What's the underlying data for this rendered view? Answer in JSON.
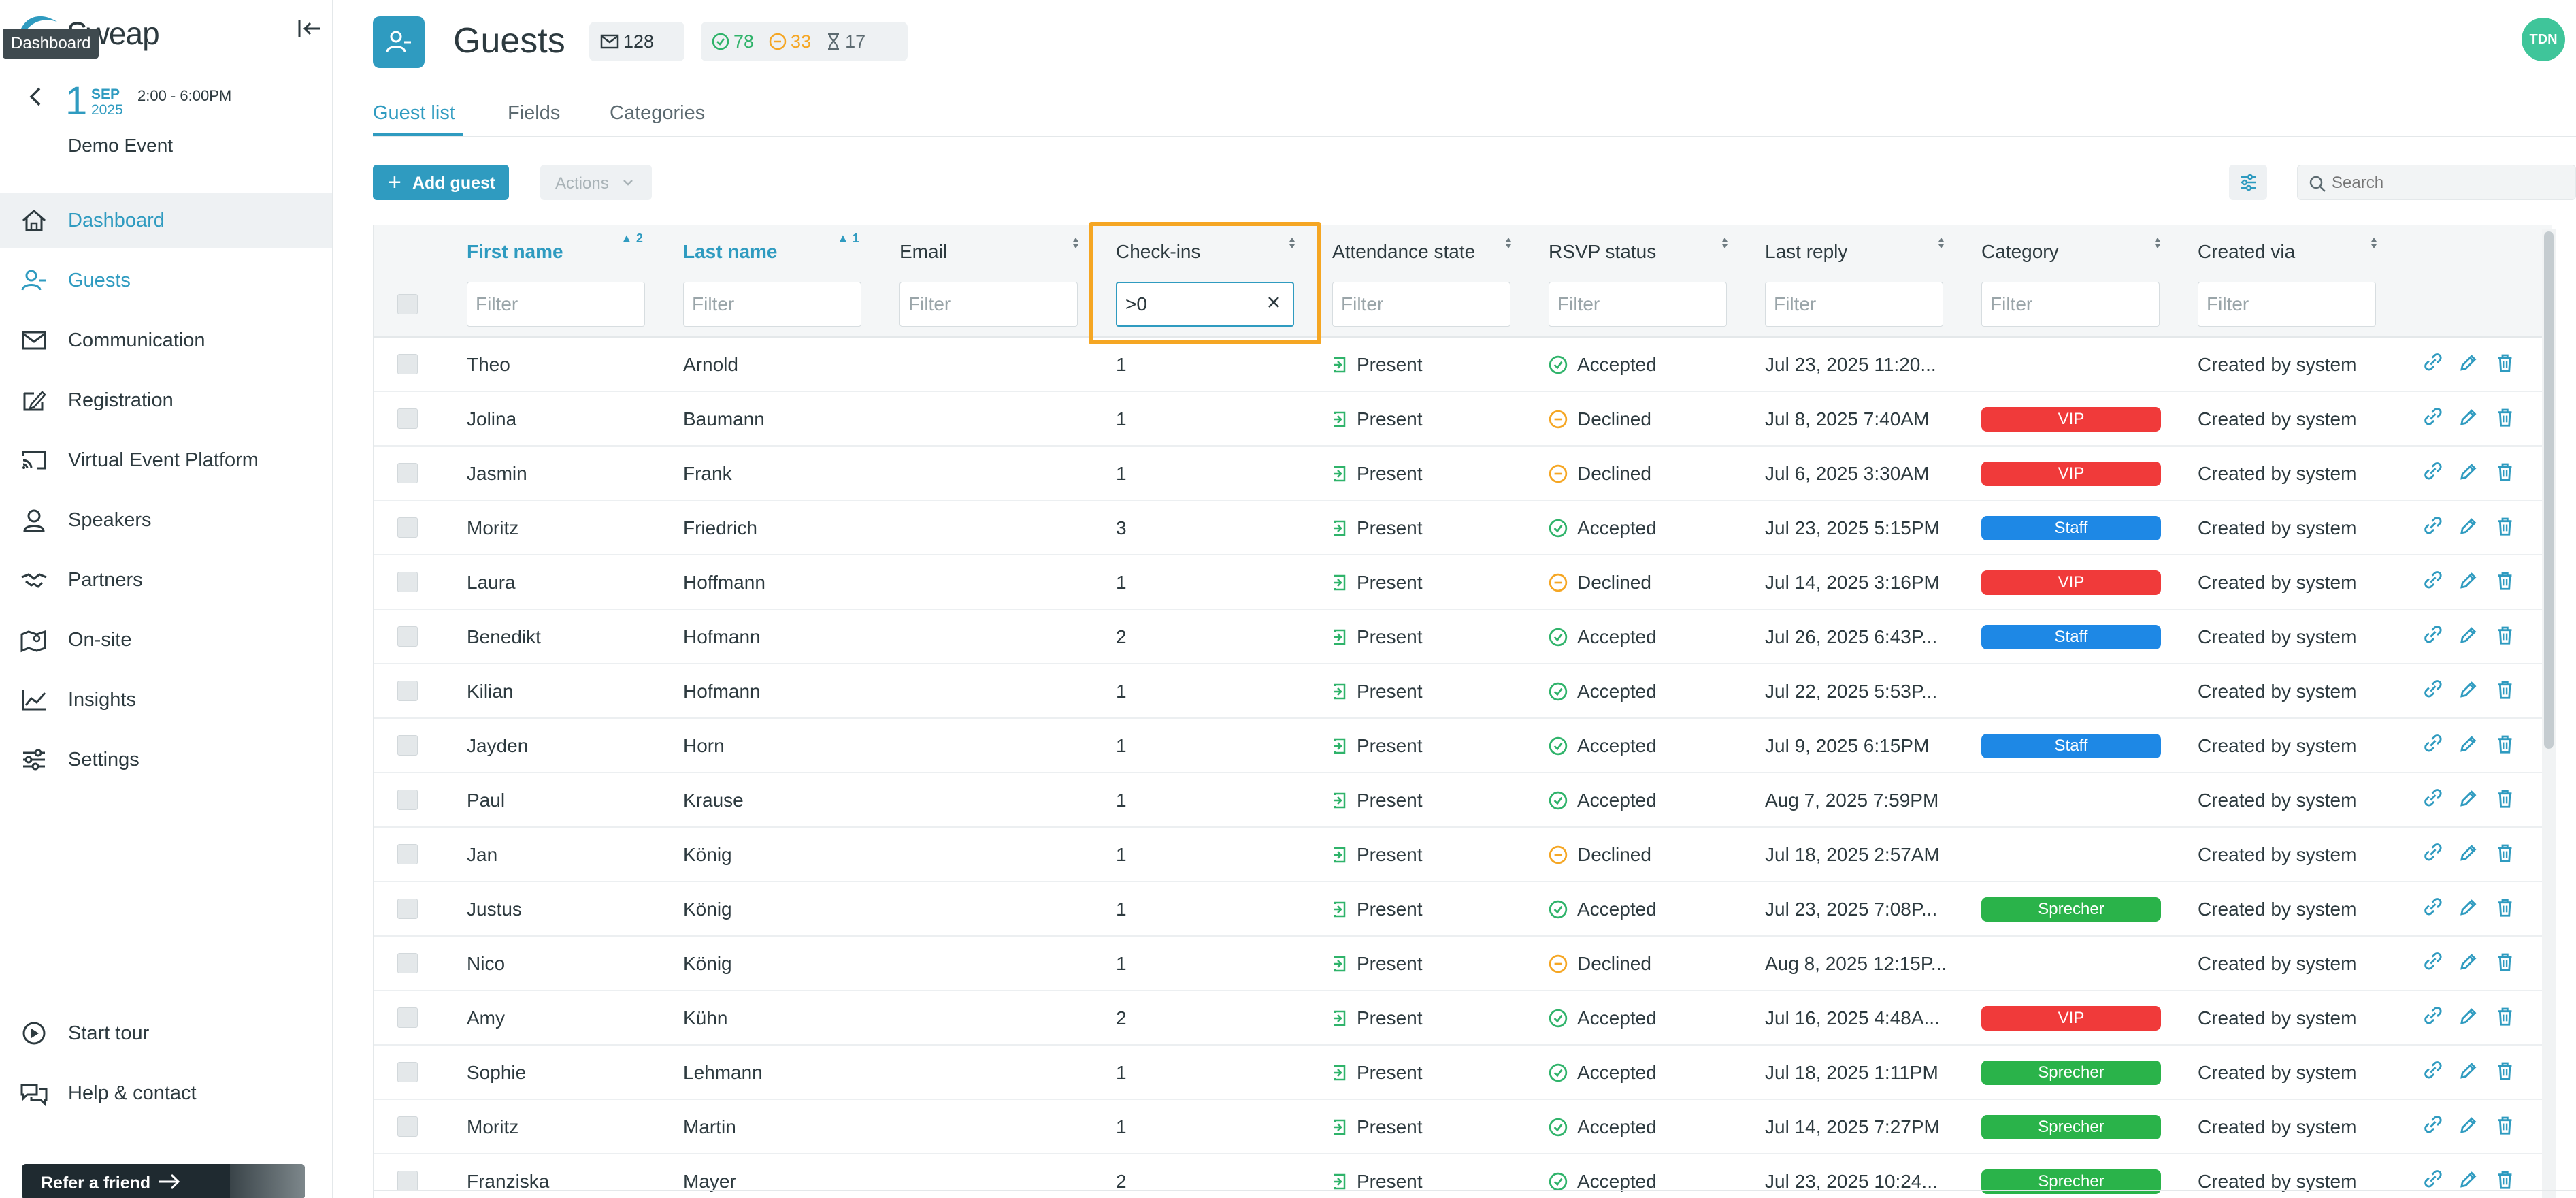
{
  "app": {
    "logo_text": "Sweap",
    "tooltip": "Dashboard"
  },
  "event": {
    "day": "1",
    "month": "SEP",
    "year": "2025",
    "time": "2:00 - 6:00PM",
    "name": "Demo Event"
  },
  "sidebar": {
    "items": [
      {
        "label": "Dashboard",
        "icon": "home-icon"
      },
      {
        "label": "Guests",
        "icon": "guests-icon"
      },
      {
        "label": "Communication",
        "icon": "mail-icon"
      },
      {
        "label": "Registration",
        "icon": "registration-icon"
      },
      {
        "label": "Virtual Event Platform",
        "icon": "cast-icon"
      },
      {
        "label": "Speakers",
        "icon": "speaker-icon"
      },
      {
        "label": "Partners",
        "icon": "handshake-icon"
      },
      {
        "label": "On-site",
        "icon": "map-icon"
      },
      {
        "label": "Insights",
        "icon": "chart-icon"
      },
      {
        "label": "Settings",
        "icon": "sliders-icon"
      }
    ],
    "bottom": [
      {
        "label": "Start tour",
        "icon": "play-icon"
      },
      {
        "label": "Help & contact",
        "icon": "chat-icon"
      }
    ],
    "refer_label": "Refer a friend"
  },
  "header": {
    "title": "Guests",
    "invited_count": "128",
    "accepted_count": "78",
    "declined_count": "33",
    "pending_count": "17",
    "avatar_initials": "TDN"
  },
  "tabs": [
    {
      "label": "Guest list"
    },
    {
      "label": "Fields"
    },
    {
      "label": "Categories"
    }
  ],
  "toolbar": {
    "add_guest": "Add guest",
    "actions": "Actions",
    "search_placeholder": "Search"
  },
  "table": {
    "filter_placeholder": "Filter",
    "columns": [
      {
        "label": "First name",
        "sort": "2"
      },
      {
        "label": "Last name",
        "sort": "1"
      },
      {
        "label": "Email"
      },
      {
        "label": "Check-ins",
        "filter_value": ">0"
      },
      {
        "label": "Attendance state"
      },
      {
        "label": "RSVP status"
      },
      {
        "label": "Last reply"
      },
      {
        "label": "Category"
      },
      {
        "label": "Created via"
      }
    ],
    "rows": [
      {
        "first": "Theo",
        "last": "Arnold",
        "email": "",
        "checkins": "1",
        "attendance": "Present",
        "rsvp": "Accepted",
        "last_reply": "Jul 23, 2025 11:20...",
        "category": "",
        "created": "Created by system"
      },
      {
        "first": "Jolina",
        "last": "Baumann",
        "email": "",
        "checkins": "1",
        "attendance": "Present",
        "rsvp": "Declined",
        "last_reply": "Jul 8, 2025 7:40AM",
        "category": "VIP",
        "created": "Created by system"
      },
      {
        "first": "Jasmin",
        "last": "Frank",
        "email": "",
        "checkins": "1",
        "attendance": "Present",
        "rsvp": "Declined",
        "last_reply": "Jul 6, 2025 3:30AM",
        "category": "VIP",
        "created": "Created by system"
      },
      {
        "first": "Moritz",
        "last": "Friedrich",
        "email": "",
        "checkins": "3",
        "attendance": "Present",
        "rsvp": "Accepted",
        "last_reply": "Jul 23, 2025 5:15PM",
        "category": "Staff",
        "created": "Created by system"
      },
      {
        "first": "Laura",
        "last": "Hoffmann",
        "email": "",
        "checkins": "1",
        "attendance": "Present",
        "rsvp": "Declined",
        "last_reply": "Jul 14, 2025 3:16PM",
        "category": "VIP",
        "created": "Created by system"
      },
      {
        "first": "Benedikt",
        "last": "Hofmann",
        "email": "",
        "checkins": "2",
        "attendance": "Present",
        "rsvp": "Accepted",
        "last_reply": "Jul 26, 2025 6:43P...",
        "category": "Staff",
        "created": "Created by system"
      },
      {
        "first": "Kilian",
        "last": "Hofmann",
        "email": "",
        "checkins": "1",
        "attendance": "Present",
        "rsvp": "Accepted",
        "last_reply": "Jul 22, 2025 5:53P...",
        "category": "",
        "created": "Created by system"
      },
      {
        "first": "Jayden",
        "last": "Horn",
        "email": "",
        "checkins": "1",
        "attendance": "Present",
        "rsvp": "Accepted",
        "last_reply": "Jul 9, 2025 6:15PM",
        "category": "Staff",
        "created": "Created by system"
      },
      {
        "first": "Paul",
        "last": "Krause",
        "email": "",
        "checkins": "1",
        "attendance": "Present",
        "rsvp": "Accepted",
        "last_reply": "Aug 7, 2025 7:59PM",
        "category": "",
        "created": "Created by system"
      },
      {
        "first": "Jan",
        "last": "König",
        "email": "",
        "checkins": "1",
        "attendance": "Present",
        "rsvp": "Declined",
        "last_reply": "Jul 18, 2025 2:57AM",
        "category": "",
        "created": "Created by system"
      },
      {
        "first": "Justus",
        "last": "König",
        "email": "",
        "checkins": "1",
        "attendance": "Present",
        "rsvp": "Accepted",
        "last_reply": "Jul 23, 2025 7:08P...",
        "category": "Sprecher",
        "created": "Created by system"
      },
      {
        "first": "Nico",
        "last": "König",
        "email": "",
        "checkins": "1",
        "attendance": "Present",
        "rsvp": "Declined",
        "last_reply": "Aug 8, 2025 12:15P...",
        "category": "",
        "created": "Created by system"
      },
      {
        "first": "Amy",
        "last": "Kühn",
        "email": "",
        "checkins": "2",
        "attendance": "Present",
        "rsvp": "Accepted",
        "last_reply": "Jul 16, 2025 4:48A...",
        "category": "VIP",
        "created": "Created by system"
      },
      {
        "first": "Sophie",
        "last": "Lehmann",
        "email": "",
        "checkins": "1",
        "attendance": "Present",
        "rsvp": "Accepted",
        "last_reply": "Jul 18, 2025 1:11PM",
        "category": "Sprecher",
        "created": "Created by system"
      },
      {
        "first": "Moritz",
        "last": "Martin",
        "email": "",
        "checkins": "1",
        "attendance": "Present",
        "rsvp": "Accepted",
        "last_reply": "Jul 14, 2025 7:27PM",
        "category": "Sprecher",
        "created": "Created by system"
      },
      {
        "first": "Franziska",
        "last": "Mayer",
        "email": "",
        "checkins": "2",
        "attendance": "Present",
        "rsvp": "Accepted",
        "last_reply": "Jul 23, 2025 10:24...",
        "category": "Sprecher",
        "created": "Created by system"
      }
    ]
  },
  "colors": {
    "accent": "#2f9bc0",
    "present": "#2fb36a",
    "accepted": "#2fb36a",
    "declined": "#f5a623",
    "VIP": "#f03a3a",
    "Staff": "#1e88e5",
    "Sprecher": "#2ab34a",
    "highlight": "#f5a623"
  }
}
